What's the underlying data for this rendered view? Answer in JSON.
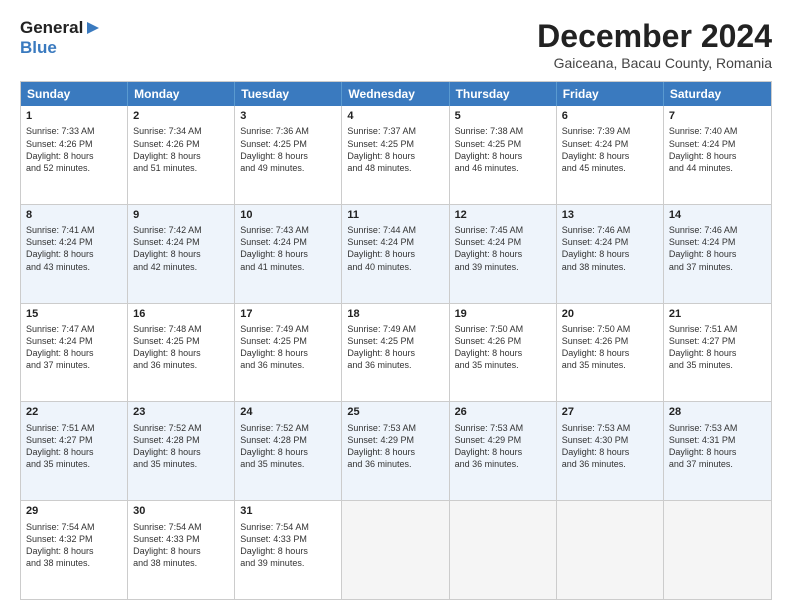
{
  "header": {
    "logo_line1": "General",
    "logo_line2": "Blue",
    "month_title": "December 2024",
    "subtitle": "Gaiceana, Bacau County, Romania"
  },
  "weekdays": [
    "Sunday",
    "Monday",
    "Tuesday",
    "Wednesday",
    "Thursday",
    "Friday",
    "Saturday"
  ],
  "rows": [
    [
      {
        "day": "1",
        "lines": [
          "Sunrise: 7:33 AM",
          "Sunset: 4:26 PM",
          "Daylight: 8 hours",
          "and 52 minutes."
        ]
      },
      {
        "day": "2",
        "lines": [
          "Sunrise: 7:34 AM",
          "Sunset: 4:26 PM",
          "Daylight: 8 hours",
          "and 51 minutes."
        ]
      },
      {
        "day": "3",
        "lines": [
          "Sunrise: 7:36 AM",
          "Sunset: 4:25 PM",
          "Daylight: 8 hours",
          "and 49 minutes."
        ]
      },
      {
        "day": "4",
        "lines": [
          "Sunrise: 7:37 AM",
          "Sunset: 4:25 PM",
          "Daylight: 8 hours",
          "and 48 minutes."
        ]
      },
      {
        "day": "5",
        "lines": [
          "Sunrise: 7:38 AM",
          "Sunset: 4:25 PM",
          "Daylight: 8 hours",
          "and 46 minutes."
        ]
      },
      {
        "day": "6",
        "lines": [
          "Sunrise: 7:39 AM",
          "Sunset: 4:24 PM",
          "Daylight: 8 hours",
          "and 45 minutes."
        ]
      },
      {
        "day": "7",
        "lines": [
          "Sunrise: 7:40 AM",
          "Sunset: 4:24 PM",
          "Daylight: 8 hours",
          "and 44 minutes."
        ]
      }
    ],
    [
      {
        "day": "8",
        "lines": [
          "Sunrise: 7:41 AM",
          "Sunset: 4:24 PM",
          "Daylight: 8 hours",
          "and 43 minutes."
        ]
      },
      {
        "day": "9",
        "lines": [
          "Sunrise: 7:42 AM",
          "Sunset: 4:24 PM",
          "Daylight: 8 hours",
          "and 42 minutes."
        ]
      },
      {
        "day": "10",
        "lines": [
          "Sunrise: 7:43 AM",
          "Sunset: 4:24 PM",
          "Daylight: 8 hours",
          "and 41 minutes."
        ]
      },
      {
        "day": "11",
        "lines": [
          "Sunrise: 7:44 AM",
          "Sunset: 4:24 PM",
          "Daylight: 8 hours",
          "and 40 minutes."
        ]
      },
      {
        "day": "12",
        "lines": [
          "Sunrise: 7:45 AM",
          "Sunset: 4:24 PM",
          "Daylight: 8 hours",
          "and 39 minutes."
        ]
      },
      {
        "day": "13",
        "lines": [
          "Sunrise: 7:46 AM",
          "Sunset: 4:24 PM",
          "Daylight: 8 hours",
          "and 38 minutes."
        ]
      },
      {
        "day": "14",
        "lines": [
          "Sunrise: 7:46 AM",
          "Sunset: 4:24 PM",
          "Daylight: 8 hours",
          "and 37 minutes."
        ]
      }
    ],
    [
      {
        "day": "15",
        "lines": [
          "Sunrise: 7:47 AM",
          "Sunset: 4:24 PM",
          "Daylight: 8 hours",
          "and 37 minutes."
        ]
      },
      {
        "day": "16",
        "lines": [
          "Sunrise: 7:48 AM",
          "Sunset: 4:25 PM",
          "Daylight: 8 hours",
          "and 36 minutes."
        ]
      },
      {
        "day": "17",
        "lines": [
          "Sunrise: 7:49 AM",
          "Sunset: 4:25 PM",
          "Daylight: 8 hours",
          "and 36 minutes."
        ]
      },
      {
        "day": "18",
        "lines": [
          "Sunrise: 7:49 AM",
          "Sunset: 4:25 PM",
          "Daylight: 8 hours",
          "and 36 minutes."
        ]
      },
      {
        "day": "19",
        "lines": [
          "Sunrise: 7:50 AM",
          "Sunset: 4:26 PM",
          "Daylight: 8 hours",
          "and 35 minutes."
        ]
      },
      {
        "day": "20",
        "lines": [
          "Sunrise: 7:50 AM",
          "Sunset: 4:26 PM",
          "Daylight: 8 hours",
          "and 35 minutes."
        ]
      },
      {
        "day": "21",
        "lines": [
          "Sunrise: 7:51 AM",
          "Sunset: 4:27 PM",
          "Daylight: 8 hours",
          "and 35 minutes."
        ]
      }
    ],
    [
      {
        "day": "22",
        "lines": [
          "Sunrise: 7:51 AM",
          "Sunset: 4:27 PM",
          "Daylight: 8 hours",
          "and 35 minutes."
        ]
      },
      {
        "day": "23",
        "lines": [
          "Sunrise: 7:52 AM",
          "Sunset: 4:28 PM",
          "Daylight: 8 hours",
          "and 35 minutes."
        ]
      },
      {
        "day": "24",
        "lines": [
          "Sunrise: 7:52 AM",
          "Sunset: 4:28 PM",
          "Daylight: 8 hours",
          "and 35 minutes."
        ]
      },
      {
        "day": "25",
        "lines": [
          "Sunrise: 7:53 AM",
          "Sunset: 4:29 PM",
          "Daylight: 8 hours",
          "and 36 minutes."
        ]
      },
      {
        "day": "26",
        "lines": [
          "Sunrise: 7:53 AM",
          "Sunset: 4:29 PM",
          "Daylight: 8 hours",
          "and 36 minutes."
        ]
      },
      {
        "day": "27",
        "lines": [
          "Sunrise: 7:53 AM",
          "Sunset: 4:30 PM",
          "Daylight: 8 hours",
          "and 36 minutes."
        ]
      },
      {
        "day": "28",
        "lines": [
          "Sunrise: 7:53 AM",
          "Sunset: 4:31 PM",
          "Daylight: 8 hours",
          "and 37 minutes."
        ]
      }
    ],
    [
      {
        "day": "29",
        "lines": [
          "Sunrise: 7:54 AM",
          "Sunset: 4:32 PM",
          "Daylight: 8 hours",
          "and 38 minutes."
        ]
      },
      {
        "day": "30",
        "lines": [
          "Sunrise: 7:54 AM",
          "Sunset: 4:33 PM",
          "Daylight: 8 hours",
          "and 38 minutes."
        ]
      },
      {
        "day": "31",
        "lines": [
          "Sunrise: 7:54 AM",
          "Sunset: 4:33 PM",
          "Daylight: 8 hours",
          "and 39 minutes."
        ]
      },
      null,
      null,
      null,
      null
    ]
  ]
}
